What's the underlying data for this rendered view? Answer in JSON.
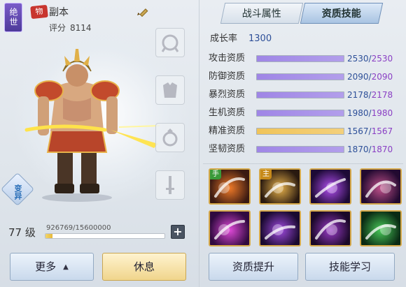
{
  "hero": {
    "rank_badge": "绝世",
    "type_badge": "物",
    "name": "副本",
    "score_label": "评分",
    "score_value": "8114",
    "transform_label": "变异",
    "level": "77 级",
    "exp_text": "926769/15600000",
    "exp_ratio": 0.0594,
    "plus_label": "+"
  },
  "buttons": {
    "more_label": "更多",
    "rest_label": "休息",
    "upgrade_aptitude_label": "资质提升",
    "learn_skill_label": "技能学习"
  },
  "tabs": [
    {
      "label": "战斗属性",
      "active": false
    },
    {
      "label": "资质技能",
      "active": true
    }
  ],
  "growth": {
    "label": "成长率",
    "value": "1300"
  },
  "stats": [
    {
      "label": "攻击资质",
      "current": "2530",
      "max": "2530",
      "ratio": 1.0,
      "color": "#9f86e6"
    },
    {
      "label": "防御资质",
      "current": "2090",
      "max": "2090",
      "ratio": 1.0,
      "color": "#9f86e6"
    },
    {
      "label": "暴烈资质",
      "current": "2178",
      "max": "2178",
      "ratio": 1.0,
      "color": "#9f86e6"
    },
    {
      "label": "生机资质",
      "current": "1980",
      "max": "1980",
      "ratio": 1.0,
      "color": "#9f86e6"
    },
    {
      "label": "精准资质",
      "current": "1567",
      "max": "1567",
      "ratio": 1.0,
      "color": "#f0c45a"
    },
    {
      "label": "坚韧资质",
      "current": "1870",
      "max": "1870",
      "ratio": 1.0,
      "color": "#9f86e6"
    }
  ],
  "skills": [
    {
      "icon": "flame-slash-skill-icon",
      "tag": "手",
      "tag_color": "#3a9a3a",
      "frame": "gold",
      "c1": "#3a1a12",
      "c2": "#f07a28"
    },
    {
      "icon": "blade-strike-skill-icon",
      "tag": "主",
      "tag_color": "#c78a1a",
      "frame": "gold",
      "c1": "#2a1a10",
      "c2": "#e8b24a"
    },
    {
      "icon": "void-shard-skill-icon",
      "tag": "",
      "tag_color": "",
      "frame": "gold",
      "c1": "#1d0a36",
      "c2": "#b24ef0"
    },
    {
      "icon": "purple-boot-skill-icon",
      "tag": "",
      "tag_color": "",
      "frame": "gold",
      "c1": "#220a30",
      "c2": "#c0508a"
    },
    {
      "icon": "dragon-head-skill-icon",
      "tag": "",
      "tag_color": "",
      "frame": "gold",
      "c1": "#300a40",
      "c2": "#e04ad8"
    },
    {
      "icon": "demon-form-skill-icon",
      "tag": "",
      "tag_color": "",
      "frame": "gold",
      "c1": "#1a0a30",
      "c2": "#a04ae0"
    },
    {
      "icon": "dark-wing-skill-icon",
      "tag": "",
      "tag_color": "",
      "frame": "gold",
      "c1": "#1a0828",
      "c2": "#9a3ac8"
    },
    {
      "icon": "green-claw-skill-icon",
      "tag": "",
      "tag_color": "",
      "frame": "gold",
      "c1": "#0a2a14",
      "c2": "#48c858"
    }
  ]
}
